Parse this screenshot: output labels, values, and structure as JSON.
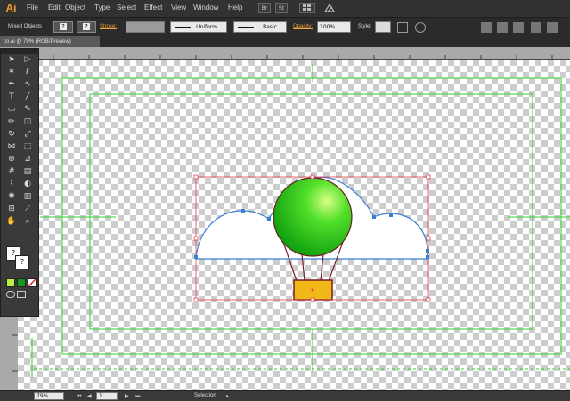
{
  "app": {
    "logo": "Ai"
  },
  "menu": [
    "File",
    "Edit",
    "Object",
    "Type",
    "Select",
    "Effect",
    "View",
    "Window",
    "Help"
  ],
  "menu_chips": [
    "Br",
    "St"
  ],
  "control": {
    "selection_label": "Mixed Objects",
    "stroke_label": "Stroke:",
    "uniform_label": "Uniform",
    "basic_label": "Basic",
    "opacity_label": "Opacity:",
    "opacity_value": "100%",
    "style_label": "Style:",
    "unknown_glyph": "?"
  },
  "document": {
    "tab_title": "co.ai @ 79% (RGB/Preview)"
  },
  "status": {
    "zoom": "79%",
    "page": "1",
    "tool": "Selection"
  },
  "colors": {
    "accent": "#f2a33a",
    "artboard_guide": "#2fd32f",
    "selection": "#e0414b",
    "cloud_stroke": "#3a7fd6",
    "balloon": "#3bd31a",
    "basket": "#f2b817"
  },
  "tools": [
    "selection-tool",
    "direct-selection-tool",
    "magic-wand-tool",
    "lasso-tool",
    "pen-tool",
    "curvature-tool",
    "type-tool",
    "line-tool",
    "rectangle-tool",
    "paintbrush-tool",
    "pencil-tool",
    "eraser-tool",
    "rotate-tool",
    "scale-tool",
    "width-tool",
    "free-transform-tool",
    "shape-builder-tool",
    "perspective-tool",
    "mesh-tool",
    "gradient-tool",
    "eyedropper-tool",
    "blend-tool",
    "symbol-sprayer-tool",
    "graph-tool",
    "artboard-tool",
    "slice-tool",
    "hand-tool",
    "zoom-tool"
  ]
}
